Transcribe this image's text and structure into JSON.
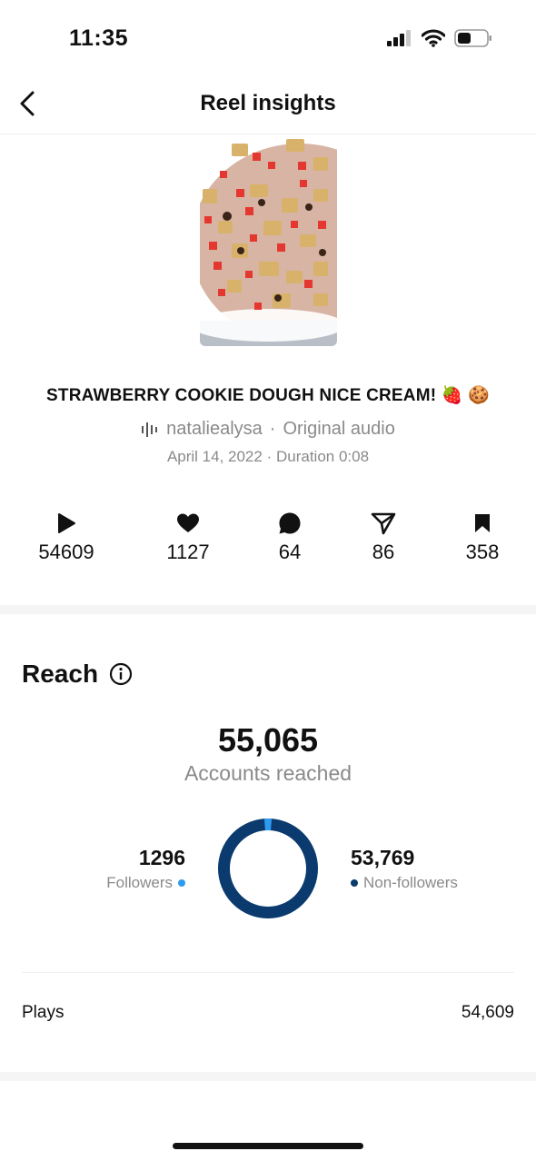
{
  "status_bar": {
    "time": "11:35"
  },
  "nav": {
    "title": "Reel insights",
    "back_icon": "chevron-left-icon"
  },
  "reel": {
    "title": "STRAWBERRY COOKIE DOUGH NICE CREAM! 🍓 🍪",
    "username": "nataliealysa",
    "audio": "Original audio",
    "date": "April 14, 2022",
    "duration": "Duration 0:08"
  },
  "stats": [
    {
      "icon": "play-icon",
      "value": "54609"
    },
    {
      "icon": "heart-icon",
      "value": "1127"
    },
    {
      "icon": "comment-icon",
      "value": "64"
    },
    {
      "icon": "share-icon",
      "value": "86"
    },
    {
      "icon": "bookmark-icon",
      "value": "358"
    }
  ],
  "reach": {
    "title": "Reach",
    "accounts_reached": "55,065",
    "accounts_label": "Accounts reached",
    "followers": {
      "value": "1296",
      "label": "Followers",
      "color": "#2e9bf0"
    },
    "non_followers": {
      "value": "53,769",
      "label": "Non-followers",
      "color": "#0a3a6e"
    },
    "followers_fraction": 0.0235
  },
  "plays": {
    "label": "Plays",
    "value": "54,609"
  }
}
